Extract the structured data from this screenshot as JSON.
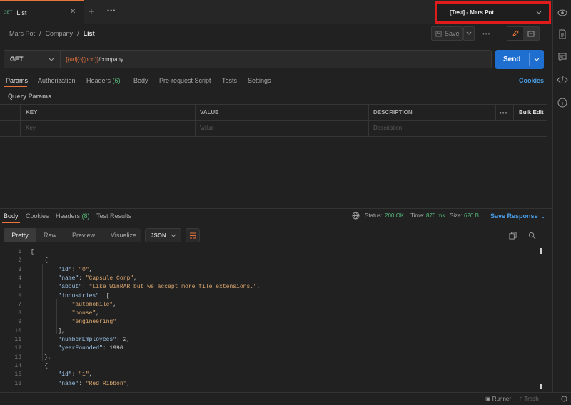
{
  "tab": {
    "method": "GET",
    "name": "List"
  },
  "environment": {
    "label": "[Test] - Mars Pot"
  },
  "breadcrumb": {
    "items": [
      "Mars Pot",
      "Company"
    ],
    "current": "List",
    "sep": "/"
  },
  "toolbar": {
    "save_label": "Save"
  },
  "request": {
    "method": "GET",
    "url_var1": "{{url}}",
    "url_colon": ":",
    "url_var2": "{{port}}",
    "url_path": "/company",
    "send_label": "Send"
  },
  "request_tabs": {
    "items": [
      {
        "label": "Params"
      },
      {
        "label": "Authorization"
      },
      {
        "label": "Headers",
        "count": "(6)"
      },
      {
        "label": "Body"
      },
      {
        "label": "Pre-request Script"
      },
      {
        "label": "Tests"
      },
      {
        "label": "Settings"
      }
    ],
    "cookies_label": "Cookies"
  },
  "params": {
    "section_title": "Query Params",
    "headers": {
      "key": "KEY",
      "value": "VALUE",
      "description": "DESCRIPTION",
      "bulk_edit": "Bulk Edit"
    },
    "placeholders": {
      "key": "Key",
      "value": "Value",
      "description": "Description"
    }
  },
  "response_tabs": {
    "items": [
      {
        "label": "Body"
      },
      {
        "label": "Cookies"
      },
      {
        "label": "Headers",
        "count": "(8)"
      },
      {
        "label": "Test Results"
      }
    ]
  },
  "response_status": {
    "status_label": "Status:",
    "status_value": "200 OK",
    "time_label": "Time:",
    "time_value": "876 ms",
    "size_label": "Size:",
    "size_value": "620 B",
    "save_response": "Save Response"
  },
  "view_modes": {
    "items": [
      "Pretty",
      "Raw",
      "Preview",
      "Visualize"
    ],
    "format": "JSON"
  },
  "code_lines": [
    {
      "n": "1",
      "t": [
        [
          "p",
          "["
        ]
      ]
    },
    {
      "n": "2",
      "t": [
        [
          "p",
          "    {"
        ]
      ]
    },
    {
      "n": "3",
      "t": [
        [
          "p",
          "        "
        ],
        [
          "k",
          "\"id\""
        ],
        [
          "p",
          ": "
        ],
        [
          "s",
          "\"0\""
        ],
        [
          "p",
          ","
        ]
      ]
    },
    {
      "n": "4",
      "t": [
        [
          "p",
          "        "
        ],
        [
          "k",
          "\"name\""
        ],
        [
          "p",
          ": "
        ],
        [
          "s",
          "\"Capsule Corp\""
        ],
        [
          "p",
          ","
        ]
      ]
    },
    {
      "n": "5",
      "t": [
        [
          "p",
          "        "
        ],
        [
          "k",
          "\"about\""
        ],
        [
          "p",
          ": "
        ],
        [
          "s",
          "\"Like WinRAR but we accept more file extensions.\""
        ],
        [
          "p",
          ","
        ]
      ]
    },
    {
      "n": "6",
      "t": [
        [
          "p",
          "        "
        ],
        [
          "k",
          "\"industries\""
        ],
        [
          "p",
          ": ["
        ]
      ]
    },
    {
      "n": "7",
      "t": [
        [
          "p",
          "            "
        ],
        [
          "s",
          "\"automobile\""
        ],
        [
          "p",
          ","
        ]
      ]
    },
    {
      "n": "8",
      "t": [
        [
          "p",
          "            "
        ],
        [
          "s",
          "\"house\""
        ],
        [
          "p",
          ","
        ]
      ]
    },
    {
      "n": "9",
      "t": [
        [
          "p",
          "            "
        ],
        [
          "s",
          "\"engineering\""
        ]
      ]
    },
    {
      "n": "10",
      "t": [
        [
          "p",
          "        ],"
        ]
      ]
    },
    {
      "n": "11",
      "t": [
        [
          "p",
          "        "
        ],
        [
          "k",
          "\"numberEmployees\""
        ],
        [
          "p",
          ": 2,"
        ]
      ]
    },
    {
      "n": "12",
      "t": [
        [
          "p",
          "        "
        ],
        [
          "k",
          "\"yearFounded\""
        ],
        [
          "p",
          ": 1990"
        ]
      ]
    },
    {
      "n": "13",
      "t": [
        [
          "p",
          "    },"
        ]
      ]
    },
    {
      "n": "14",
      "t": [
        [
          "p",
          "    {"
        ]
      ]
    },
    {
      "n": "15",
      "t": [
        [
          "p",
          "        "
        ],
        [
          "k",
          "\"id\""
        ],
        [
          "p",
          ": "
        ],
        [
          "s",
          "\"1\""
        ],
        [
          "p",
          ","
        ]
      ]
    },
    {
      "n": "16",
      "t": [
        [
          "p",
          "        "
        ],
        [
          "k",
          "\"name\""
        ],
        [
          "p",
          ": "
        ],
        [
          "s",
          "\"Red Ribbon\""
        ],
        [
          "p",
          ","
        ]
      ]
    }
  ],
  "statusbar": {
    "runner": "Runner",
    "trash": "Trash"
  },
  "colors": {
    "accent": "#e8743b",
    "send": "#1f6fd1",
    "status_ok": "#55b87a",
    "link": "#4a9ee8",
    "highlight_box": "#e01b1b"
  }
}
